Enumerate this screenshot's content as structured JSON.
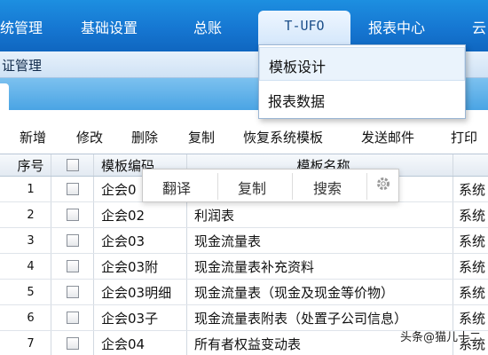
{
  "menubar": {
    "items": [
      "统管理",
      "基础设置",
      "总账",
      "T-UFO",
      "报表中心",
      "云"
    ]
  },
  "subbar": {
    "title": "证管理"
  },
  "dropdown": {
    "items": [
      "模板设计",
      "报表数据"
    ]
  },
  "toolbar": {
    "buttons": [
      "新增",
      "修改",
      "删除",
      "复制",
      "恢复系统模板",
      "发送邮件",
      "打印"
    ]
  },
  "table": {
    "headers": {
      "index": "序号",
      "code": "模板编码",
      "name": "模板名称",
      "sys": ""
    },
    "rows": [
      {
        "index": "1",
        "code": "企会0",
        "name": "",
        "sys": "系统"
      },
      {
        "index": "2",
        "code": "企会02",
        "name": "利润表",
        "sys": "系统"
      },
      {
        "index": "3",
        "code": "企会03",
        "name": "现金流量表",
        "sys": "系统"
      },
      {
        "index": "4",
        "code": "企会03附",
        "name": "现金流量表补充资料",
        "sys": "系统"
      },
      {
        "index": "5",
        "code": "企会03明细",
        "name": "现金流量表（现金及现金等价物）",
        "sys": "系统"
      },
      {
        "index": "6",
        "code": "企会03子",
        "name": "现金流量表附表（处置子公司信息）",
        "sys": "系统"
      },
      {
        "index": "7",
        "code": "企会04",
        "name": "所有者权益变动表",
        "sys": "系统"
      }
    ]
  },
  "context_popup": {
    "items": [
      "翻译",
      "复制",
      "搜索"
    ],
    "icon": "gear-icon"
  },
  "watermark": "头条@猫儿十二",
  "colors": {
    "menubar": "#1677d2",
    "tabstrip": "#4aa4e4"
  }
}
